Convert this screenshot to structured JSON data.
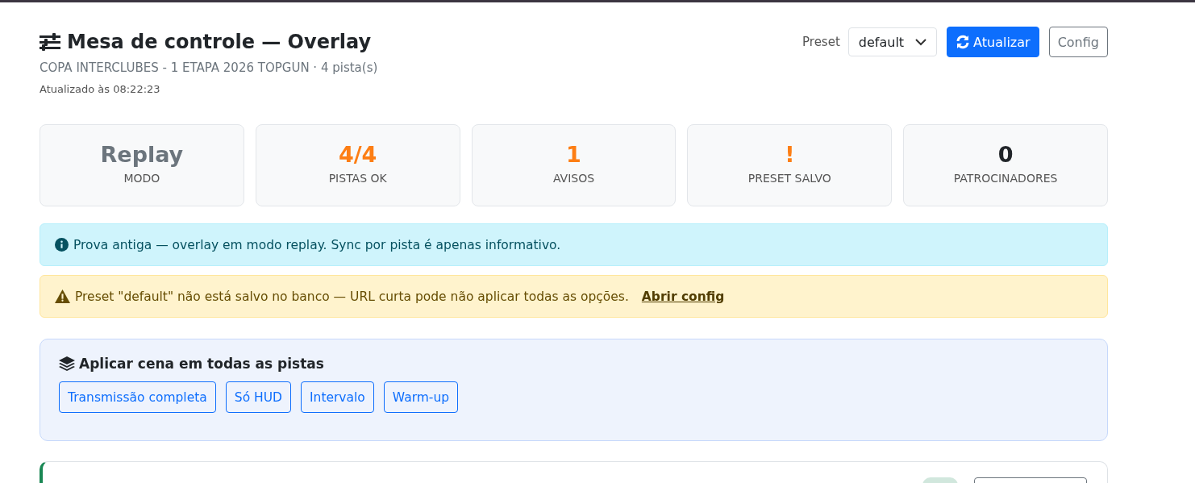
{
  "header": {
    "title": "Mesa de controle — Overlay",
    "subtitle": "COPA INTERCLUBES - 1 ETAPA 2026 TOPGUN · 4 pista(s)",
    "updated": "Atualizado às 08:22:23"
  },
  "toolbar": {
    "preset_label": "Preset",
    "preset_value": "default",
    "refresh_button": "Atualizar",
    "config_button": "Config"
  },
  "stats": [
    {
      "value": "Replay",
      "label": "MODO",
      "color": "#6c757d"
    },
    {
      "value": "4/4",
      "label": "PISTAS OK",
      "color": "#fd7e14"
    },
    {
      "value": "1",
      "label": "AVISOS",
      "color": "#fd7e14"
    },
    {
      "value": "!",
      "label": "PRESET SALVO",
      "color": "#fd7e14"
    },
    {
      "value": "0",
      "label": "PATROCINADORES",
      "color": "#212529"
    }
  ],
  "alerts": [
    {
      "kind": "info",
      "text": "Prova antiga — overlay em modo replay. Sync por pista é apenas informativo."
    },
    {
      "kind": "warning",
      "text": "Preset \"default\" não está salvo no banco — URL curta pode não aplicar todas as opções.",
      "link": "Abrir config"
    }
  ],
  "scenes": {
    "title": "Aplicar cena em todas as pistas",
    "buttons": [
      "Transmissão completa",
      "Só HUD",
      "Intervalo",
      "Warm-up"
    ]
  }
}
